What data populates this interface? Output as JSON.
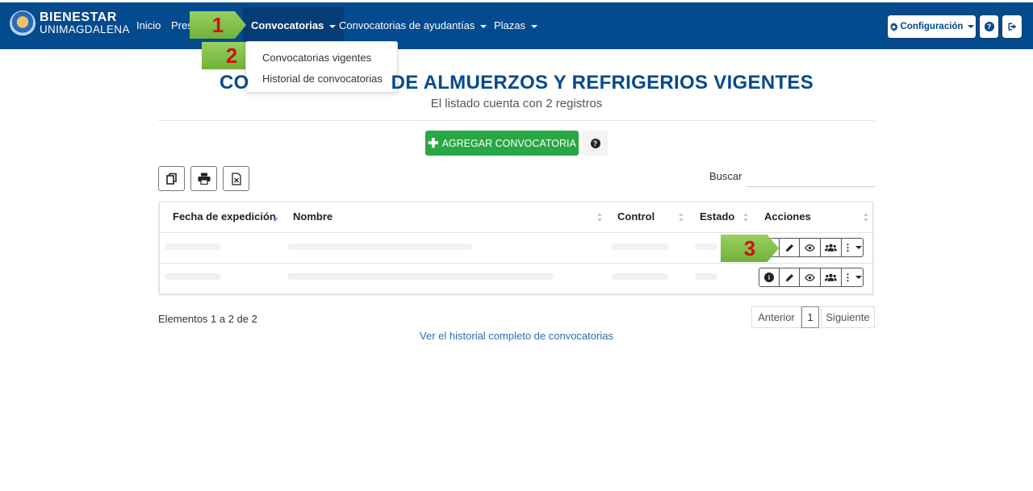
{
  "brand": {
    "top": "BIENESTAR",
    "bottom": "UNIMAGDALENA"
  },
  "nav": {
    "inicio": "Inicio",
    "presupuestos": "Pres",
    "convocatorias": "Convocatorias",
    "ayudantias": "Convocatorias de ayudantías",
    "plazas": "Plazas",
    "configuracion": "Configuración"
  },
  "dropdown": {
    "vigentes": "Convocatorias vigentes",
    "historial": "Historial de convocatorias"
  },
  "callouts": {
    "one": "1",
    "two": "2",
    "three": "3"
  },
  "page": {
    "title_left": "CO",
    "title_right": "DE ALMUERZOS Y REFRIGERIOS VIGENTES",
    "subtitle": "El listado cuenta con 2 registros",
    "add_button": "AGREGAR CONVOCATORIA",
    "search_label": "Buscar",
    "search_value": ""
  },
  "table": {
    "columns": [
      "Fecha de expedición",
      "Nombre",
      "Control",
      "Estado",
      "Acciones"
    ]
  },
  "footer": {
    "info": "Elementos 1 a 2 de 2",
    "prev": "Anterior",
    "page": "1",
    "next": "Siguiente",
    "history_link": "Ver el historial completo de convocatorias"
  },
  "colors": {
    "navbar": "#034a8f",
    "accent": "#28a745",
    "link": "#2a6db7",
    "callout": "#6fb23a"
  }
}
